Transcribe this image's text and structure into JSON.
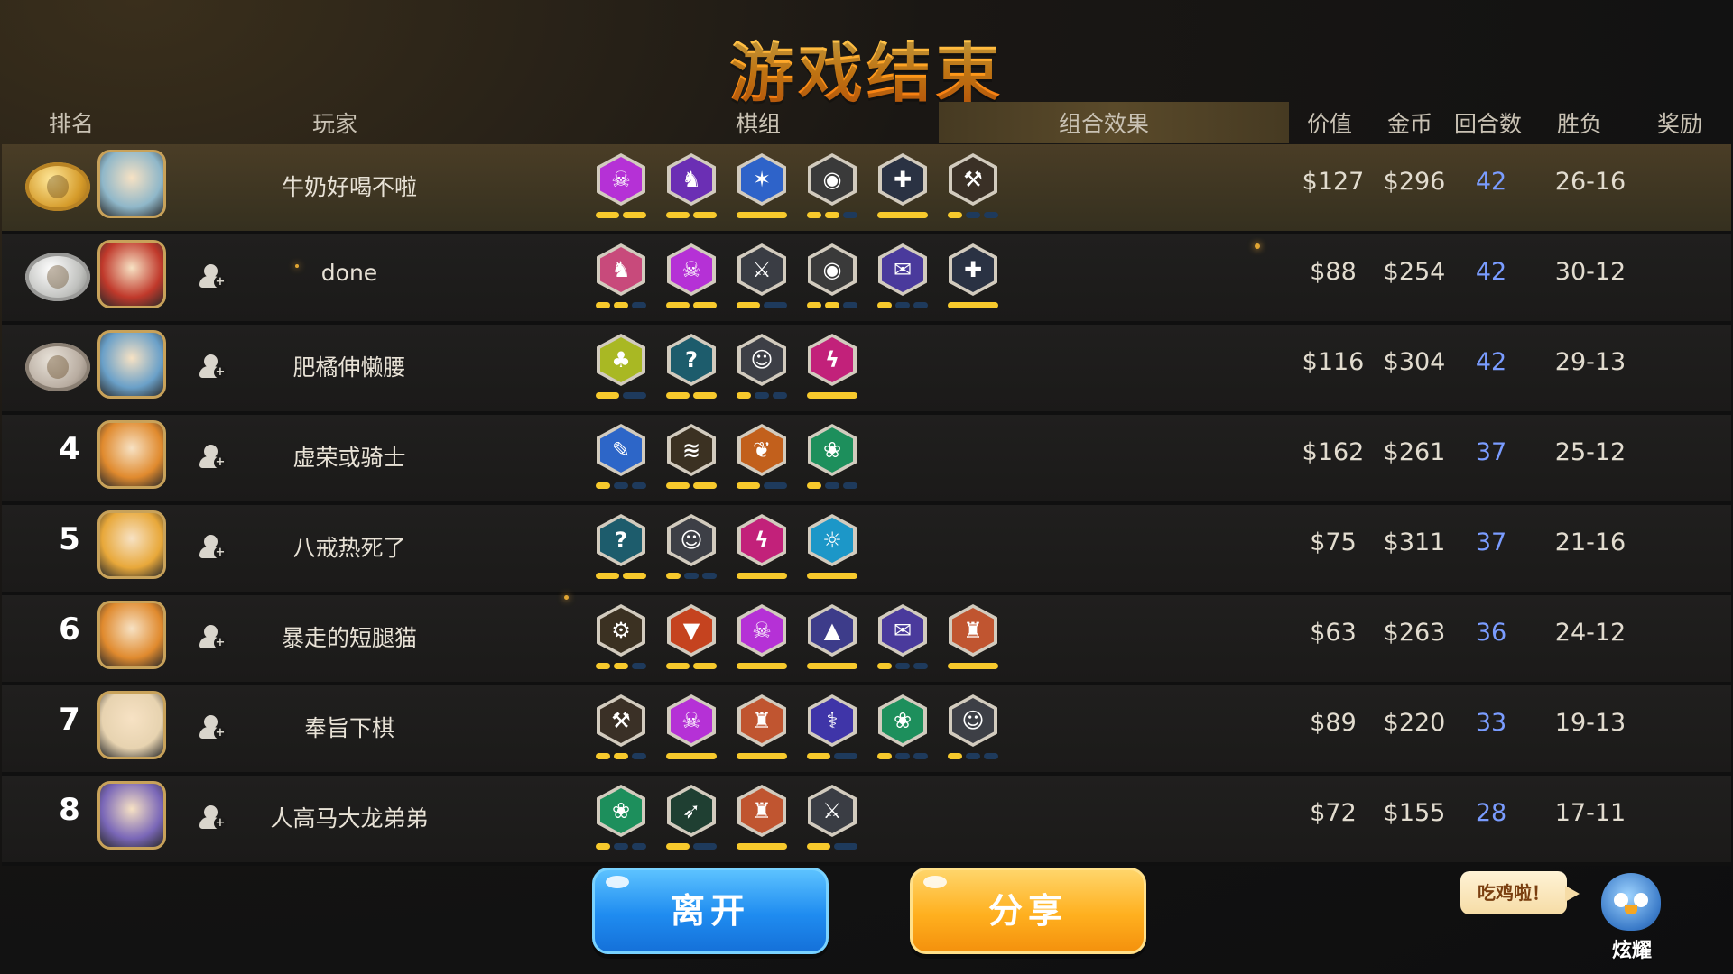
{
  "title": "游戏结束",
  "headers": {
    "rank": "排名",
    "player": "玩家",
    "lineup": "棋组",
    "synergy": "组合效果",
    "value": "价值",
    "gold": "金币",
    "rounds": "回合数",
    "record": "胜负",
    "reward": "奖励"
  },
  "rows": [
    {
      "rank": "1",
      "medal": "gold",
      "name": "牛奶好喝不啦",
      "value": "$127",
      "gold": "$296",
      "rounds": "42",
      "record": "26-16",
      "add_friend": false,
      "traits": [
        {
          "icon": "demon-icon",
          "color": "#b531d6",
          "level": 2,
          "max": 2
        },
        {
          "icon": "hunter-icon",
          "color": "#6b2fb4",
          "level": 2,
          "max": 2
        },
        {
          "icon": "storm-icon",
          "color": "#2e63c9",
          "level": 1,
          "max": 1
        },
        {
          "icon": "beast-icon",
          "color": "#3a3a3a",
          "level": 2,
          "max": 3
        },
        {
          "icon": "cross-icon",
          "color": "#2a3243",
          "level": 1,
          "max": 1
        },
        {
          "icon": "axe-icon",
          "color": "#3a3026",
          "level": 1,
          "max": 3
        }
      ]
    },
    {
      "rank": "2",
      "medal": "silver",
      "name": "done",
      "value": "$88",
      "gold": "$254",
      "rounds": "42",
      "record": "30-12",
      "add_friend": true,
      "traits": [
        {
          "icon": "knight-icon",
          "color": "#c84a7b",
          "level": 2,
          "max": 3
        },
        {
          "icon": "demon-icon",
          "color": "#b531d6",
          "level": 2,
          "max": 2
        },
        {
          "icon": "warrior-icon",
          "color": "#3a3d44",
          "level": 1,
          "max": 2
        },
        {
          "icon": "beast-icon",
          "color": "#3a3a3a",
          "level": 2,
          "max": 3
        },
        {
          "icon": "mage-book-icon",
          "color": "#4a3a9c",
          "level": 1,
          "max": 3
        },
        {
          "icon": "cross-icon",
          "color": "#2a3243",
          "level": 1,
          "max": 1
        }
      ]
    },
    {
      "rank": "3",
      "medal": "bronze",
      "name": "肥橘伸懒腰",
      "value": "$116",
      "gold": "$304",
      "rounds": "42",
      "record": "29-13",
      "add_friend": true,
      "traits": [
        {
          "icon": "troll-icon",
          "color": "#a9b823",
          "level": 1,
          "max": 2
        },
        {
          "icon": "assassin-icon",
          "color": "#1d5c6c",
          "level": 2,
          "max": 2
        },
        {
          "icon": "human-icon",
          "color": "#3d3f46",
          "level": 1,
          "max": 3
        },
        {
          "icon": "dragon-icon",
          "color": "#c2217a",
          "level": 1,
          "max": 1
        }
      ]
    },
    {
      "rank": "4",
      "medal": "",
      "name": "虚荣或骑士",
      "value": "$162",
      "gold": "$261",
      "rounds": "37",
      "record": "25-12",
      "add_friend": true,
      "traits": [
        {
          "icon": "feather-icon",
          "color": "#2d66c8",
          "level": 1,
          "max": 3
        },
        {
          "icon": "claw-icon",
          "color": "#3b3122",
          "level": 2,
          "max": 2
        },
        {
          "icon": "leaf-icon",
          "color": "#c2601c",
          "level": 1,
          "max": 2
        },
        {
          "icon": "paw-icon",
          "color": "#1d8f5c",
          "level": 1,
          "max": 3
        }
      ]
    },
    {
      "rank": "5",
      "medal": "",
      "name": "八戒热死了",
      "value": "$75",
      "gold": "$311",
      "rounds": "37",
      "record": "21-16",
      "add_friend": true,
      "traits": [
        {
          "icon": "assassin-icon",
          "color": "#1d5c6c",
          "level": 2,
          "max": 2
        },
        {
          "icon": "human-icon",
          "color": "#3d3f46",
          "level": 1,
          "max": 3
        },
        {
          "icon": "dragon-icon",
          "color": "#c2217a",
          "level": 1,
          "max": 1
        },
        {
          "icon": "elemental-icon",
          "color": "#1c97c8",
          "level": 1,
          "max": 1
        }
      ]
    },
    {
      "rank": "6",
      "medal": "",
      "name": "暴走的短腿猫",
      "value": "$63",
      "gold": "$263",
      "rounds": "36",
      "record": "24-12",
      "add_friend": true,
      "traits": [
        {
          "icon": "gear-icon",
          "color": "#3b3122",
          "level": 2,
          "max": 3
        },
        {
          "icon": "goblin-icon",
          "color": "#c5431f",
          "level": 2,
          "max": 2
        },
        {
          "icon": "demon-icon",
          "color": "#b531d6",
          "level": 1,
          "max": 1
        },
        {
          "icon": "witch-hat-icon",
          "color": "#3d3c8a",
          "level": 1,
          "max": 1
        },
        {
          "icon": "mage-book-icon",
          "color": "#4a3a9c",
          "level": 1,
          "max": 3
        },
        {
          "icon": "viking-icon",
          "color": "#c05530",
          "level": 1,
          "max": 1
        }
      ]
    },
    {
      "rank": "7",
      "medal": "",
      "name": "奉旨下棋",
      "value": "$89",
      "gold": "$220",
      "rounds": "33",
      "record": "19-13",
      "add_friend": true,
      "traits": [
        {
          "icon": "axe-icon",
          "color": "#3a3026",
          "level": 2,
          "max": 3
        },
        {
          "icon": "demon-icon",
          "color": "#b531d6",
          "level": 1,
          "max": 1
        },
        {
          "icon": "viking-icon",
          "color": "#c05530",
          "level": 1,
          "max": 1
        },
        {
          "icon": "fish-bone-icon",
          "color": "#3f35a8",
          "level": 1,
          "max": 2
        },
        {
          "icon": "paw-icon",
          "color": "#1d8f5c",
          "level": 1,
          "max": 3
        },
        {
          "icon": "human-icon",
          "color": "#3d3f46",
          "level": 1,
          "max": 3
        }
      ]
    },
    {
      "rank": "8",
      "medal": "",
      "name": "人高马大龙弟弟",
      "value": "$72",
      "gold": "$155",
      "rounds": "28",
      "record": "17-11",
      "add_friend": true,
      "traits": [
        {
          "icon": "paw-icon",
          "color": "#1d8f5c",
          "level": 1,
          "max": 3
        },
        {
          "icon": "bow-icon",
          "color": "#1f3f32",
          "level": 1,
          "max": 2
        },
        {
          "icon": "viking-icon",
          "color": "#c05530",
          "level": 1,
          "max": 1
        },
        {
          "icon": "warrior-icon",
          "color": "#3a3d44",
          "level": 1,
          "max": 2
        }
      ]
    }
  ],
  "buttons": {
    "leave": "离开",
    "share": "分享"
  },
  "brag": {
    "bubble": "吃鸡啦！",
    "label": "炫耀"
  }
}
